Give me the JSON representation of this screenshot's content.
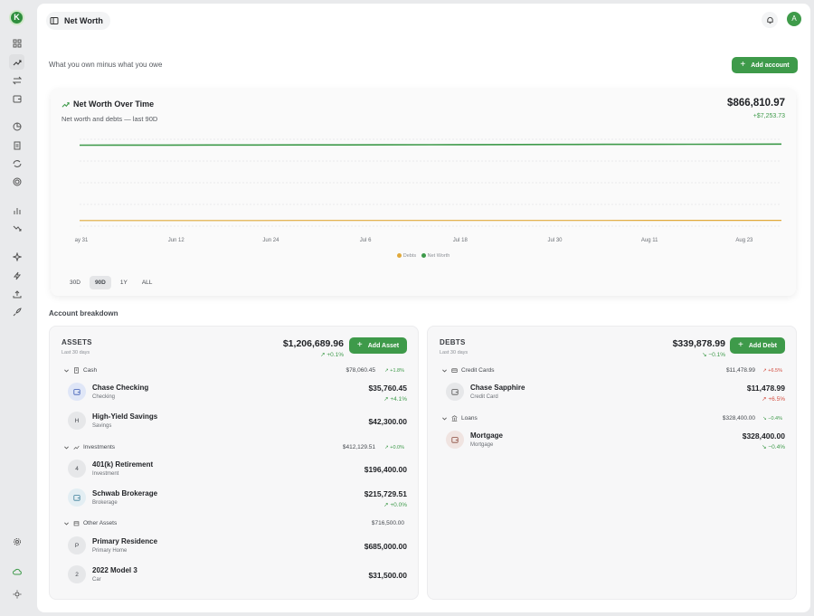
{
  "app": {
    "logo_letter": "K"
  },
  "sidebar": {
    "items": [
      {
        "name": "dashboard-icon"
      },
      {
        "name": "trending-up-icon",
        "active": true
      },
      {
        "name": "transfer-icon"
      },
      {
        "name": "wallet-icon"
      },
      {
        "name": "pie-chart-icon"
      },
      {
        "name": "receipt-icon"
      },
      {
        "name": "repeat-icon"
      },
      {
        "name": "target-icon"
      },
      {
        "name": "bar-chart-icon"
      },
      {
        "name": "trending-down-icon"
      },
      {
        "name": "sparkle-icon"
      },
      {
        "name": "zap-icon"
      },
      {
        "name": "upload-icon"
      },
      {
        "name": "rocket-icon"
      },
      {
        "name": "settings-icon"
      },
      {
        "name": "cloud-icon"
      },
      {
        "name": "sun-icon"
      }
    ]
  },
  "header": {
    "title": "Net Worth",
    "avatar_initial": "A"
  },
  "page": {
    "subtitle": "What you own minus what you owe",
    "add_account_label": "Add account"
  },
  "chart_card": {
    "title": "Net Worth Over Time",
    "subtitle": "Net worth and debts — last 90D",
    "total": "$866,810.97",
    "change": "+$7,253.73",
    "ranges": [
      "30D",
      "90D",
      "1Y",
      "ALL"
    ],
    "selected_range": "90D"
  },
  "chart_data": {
    "type": "line",
    "x_tick_labels": [
      "ay 31",
      "Jun 12",
      "Jun 24",
      "Jul 6",
      "Jul 18",
      "Jul 30",
      "Aug 11",
      "Aug 23"
    ],
    "series": [
      {
        "name": "Net Worth",
        "color": "#3e9a4a",
        "values": [
          859557,
          859800,
          860000,
          860400,
          860700,
          861000,
          861500,
          862000,
          862500,
          863000,
          863600,
          864200,
          864800,
          865300,
          865900,
          866400,
          866811
        ]
      },
      {
        "name": "Debts",
        "color": "#e0a93b",
        "values": [
          338600,
          338700,
          338800,
          338900,
          339000,
          339100,
          339200,
          339300,
          339400,
          339450,
          339500,
          339550,
          339600,
          339700,
          339750,
          339800,
          339879
        ]
      }
    ],
    "legend": [
      "Debts",
      "Net Worth"
    ],
    "grid": true,
    "ylim": [
      300000,
      900000
    ]
  },
  "breakdown": {
    "title": "Account breakdown",
    "assets": {
      "heading": "ASSETS",
      "period": "Last 30 days",
      "total": "$1,206,689.96",
      "change": "↗ +0.1%",
      "add_label": "Add Asset",
      "groups": [
        {
          "name": "Cash",
          "icon": "building-icon",
          "total": "$78,060.45",
          "change": "↗ +1.8%",
          "accounts": [
            {
              "name": "Chase Checking",
              "type": "Checking",
              "badge": "",
              "icon": "wallet-icon",
              "balance": "$35,760.45",
              "change": "↗ +4.1%",
              "tint": "#dfe6f7"
            },
            {
              "name": "High-Yield Savings",
              "type": "Savings",
              "badge": "H",
              "balance": "$42,300.00",
              "change": ""
            }
          ]
        },
        {
          "name": "Investments",
          "icon": "trending-up-icon",
          "total": "$412,129.51",
          "change": "↗ +0.0%",
          "accounts": [
            {
              "name": "401(k) Retirement",
              "type": "Investment",
              "badge": "4",
              "balance": "$196,400.00",
              "change": ""
            },
            {
              "name": "Schwab Brokerage",
              "type": "Brokerage",
              "badge": "",
              "icon": "wallet-icon",
              "balance": "$215,729.51",
              "change": "↗ +0.0%",
              "tint": "#e3eef3"
            }
          ]
        },
        {
          "name": "Other Assets",
          "icon": "box-icon",
          "total": "$716,500.00",
          "change": "",
          "accounts": [
            {
              "name": "Primary Residence",
              "type": "Primary Home",
              "badge": "P",
              "balance": "$685,000.00",
              "change": ""
            },
            {
              "name": "2022 Model 3",
              "type": "Car",
              "badge": "2",
              "balance": "$31,500.00",
              "change": ""
            }
          ]
        }
      ]
    },
    "debts": {
      "heading": "DEBTS",
      "period": "Last 30 days",
      "total": "$339,878.99",
      "change": "↘ −0.1%",
      "add_label": "Add Debt",
      "groups": [
        {
          "name": "Credit Cards",
          "icon": "credit-card-icon",
          "total": "$11,478.99",
          "change": "↗ +6.5%",
          "accounts": [
            {
              "name": "Chase Sapphire",
              "type": "Credit Card",
              "badge": "",
              "icon": "wallet-icon",
              "balance": "$11,478.99",
              "change": "↗ +6.5%",
              "tint": "#e6e7e9"
            }
          ]
        },
        {
          "name": "Loans",
          "icon": "bank-icon",
          "total": "$328,400.00",
          "change": "↘ −0.4%",
          "accounts": [
            {
              "name": "Mortgage",
              "type": "Mortgage",
              "badge": "",
              "icon": "wallet-icon",
              "balance": "$328,400.00",
              "change": "↘ −0.4%",
              "tint": "#f0e4e1"
            }
          ]
        }
      ]
    }
  }
}
